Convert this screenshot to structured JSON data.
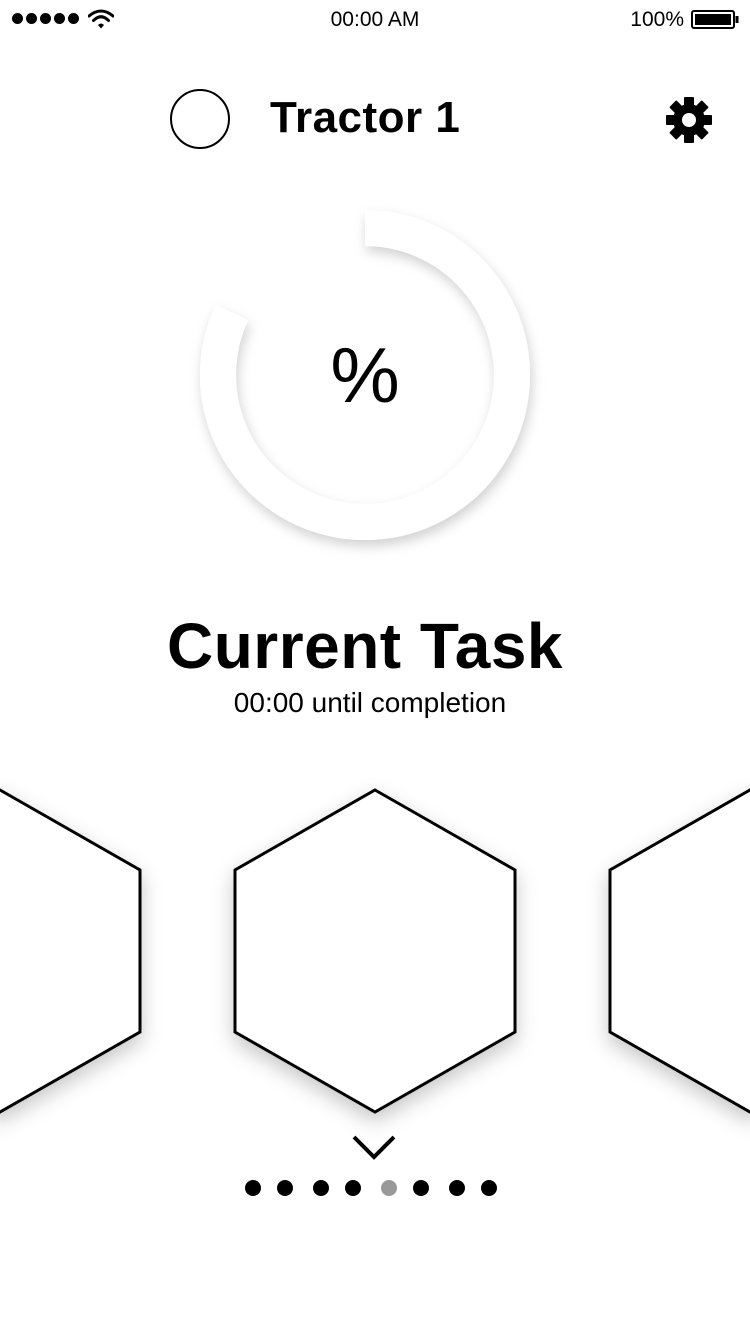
{
  "status_bar": {
    "signal_bars": 5,
    "time": "00:00 AM",
    "battery_percent": "100%"
  },
  "header": {
    "title": "Tractor 1",
    "avatar_icon": "circle-avatar-icon",
    "settings_icon": "gear-icon"
  },
  "progress": {
    "label": "%",
    "value": 0.82
  },
  "task": {
    "title": "Current Task",
    "eta": "00:00 until completion"
  },
  "carousel": {
    "items": [
      "hexagon-previous",
      "hexagon-current",
      "hexagon-next"
    ],
    "expand_icon": "chevron-down-icon"
  },
  "pagination": {
    "count": 8,
    "active_index": 4,
    "active_color": "#999999",
    "inactive_color": "#000000"
  }
}
